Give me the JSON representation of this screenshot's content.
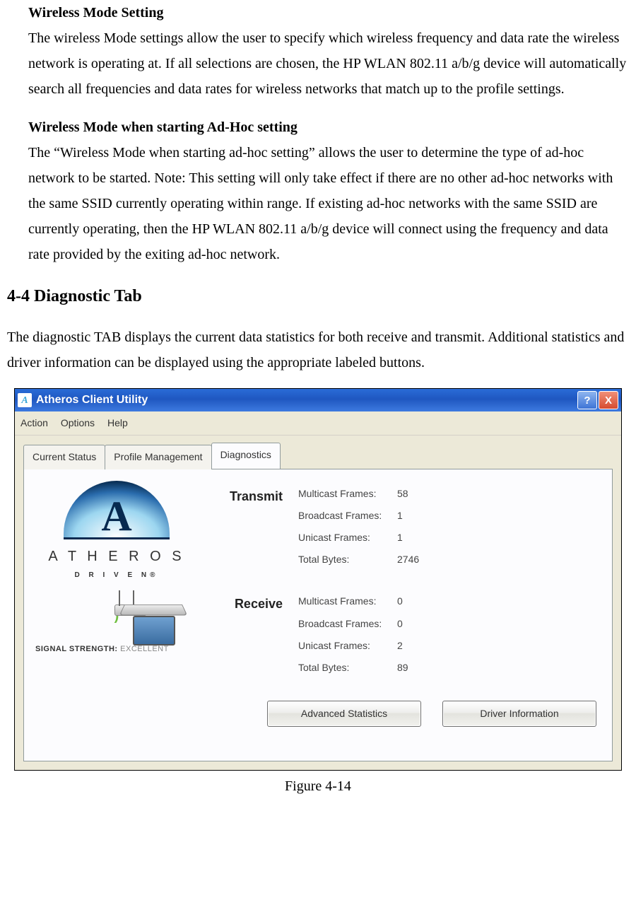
{
  "doc": {
    "s1_title": "Wireless Mode Setting",
    "s1_body": "The wireless Mode settings allow the user to specify which wireless frequency and data rate the wireless network is operating at.  If all selections are chosen, the HP WLAN 802.11 a/b/g device will automatically search all frequencies and data rates for wireless networks that match up to the profile settings.",
    "s2_title": "Wireless Mode when starting Ad-Hoc setting",
    "s2_body": "The “Wireless Mode when starting ad-hoc setting” allows the user to determine the type of ad-hoc network to be started.  Note: This setting will only take effect if there are no other ad-hoc networks with the same SSID currently operating within range.  If existing ad-hoc networks with the same SSID are currently operating, then the HP WLAN 802.11 a/b/g  device will connect using the frequency and data rate provided by the exiting ad-hoc network.",
    "h2": "4-4 Diagnostic Tab",
    "h2_body": "The diagnostic TAB displays the current data statistics for both receive and transmit.  Additional statistics and driver information can be displayed using the appropriate labeled buttons.",
    "figure_caption": "Figure 4-14"
  },
  "win": {
    "title": "Atheros Client Utility",
    "icon_letter": "A",
    "help_glyph": "?",
    "close_glyph": "X",
    "menu": {
      "action": "Action",
      "options": "Options",
      "help": "Help"
    },
    "tabs": {
      "t1": "Current Status",
      "t2": "Profile Management",
      "t3": "Diagnostics"
    },
    "brand": {
      "big": "A T H E R O S",
      "small": "D R I V E N®"
    },
    "signal": {
      "label": "SIGNAL STRENGTH:",
      "value": "EXCELLENT"
    },
    "transmit": {
      "heading": "Transmit",
      "rows": [
        {
          "label": "Multicast Frames:",
          "value": "58"
        },
        {
          "label": "Broadcast Frames:",
          "value": "1"
        },
        {
          "label": "Unicast Frames:",
          "value": "1"
        },
        {
          "label": "Total Bytes:",
          "value": "2746"
        }
      ]
    },
    "receive": {
      "heading": "Receive",
      "rows": [
        {
          "label": "Multicast Frames:",
          "value": "0"
        },
        {
          "label": "Broadcast Frames:",
          "value": "0"
        },
        {
          "label": "Unicast Frames:",
          "value": "2"
        },
        {
          "label": "Total Bytes:",
          "value": "89"
        }
      ]
    },
    "buttons": {
      "adv": "Advanced Statistics",
      "drv": "Driver Information"
    }
  }
}
